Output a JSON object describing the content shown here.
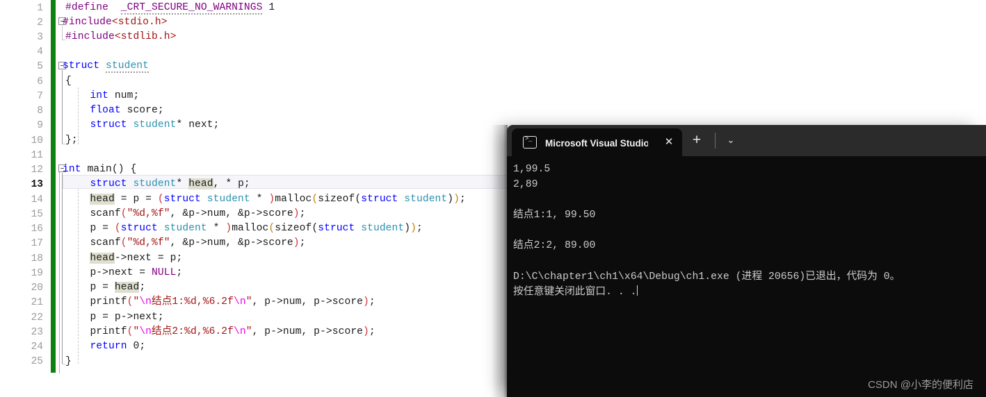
{
  "editor": {
    "line_numbers": [
      "1",
      "2",
      "3",
      "4",
      "5",
      "6",
      "7",
      "8",
      "9",
      "10",
      "11",
      "12",
      "13",
      "14",
      "15",
      "16",
      "17",
      "18",
      "19",
      "20",
      "21",
      "22",
      "23",
      "24",
      "25"
    ],
    "current_line": "13",
    "lines": [
      "#define  _CRT_SECURE_NO_WARNINGS 1",
      "#include<stdio.h>",
      "#include<stdlib.h>",
      "",
      "struct student",
      "{",
      "    int num;",
      "    float score;",
      "    struct student* next;",
      "};",
      "",
      "int main() {",
      "    struct student* head, * p;",
      "    head = p = (struct student * )malloc(sizeof(struct student));",
      "    scanf(\"%d,%f\", &p->num, &p->score);",
      "    p = (struct student * )malloc(sizeof(struct student));",
      "    scanf(\"%d,%f\", &p->num, &p->score);",
      "    head->next = p;",
      "    p->next = NULL;",
      "    p = head;",
      "    printf(\"\\n结点1:%d,%6.2f\\n\", p->num, p->score);",
      "    p = p->next;",
      "    printf(\"\\n结点2:%d,%6.2f\\n\", p->num, p->score);",
      "    return 0;",
      "}"
    ],
    "highlighted_symbol": "head",
    "change_bar_color": "#108010"
  },
  "console": {
    "tab_title": "Microsoft Visual Studio 调试控制台",
    "tab_icon": "console-icon",
    "close_label": "✕",
    "new_tab_label": "+",
    "dropdown_label": "⌄",
    "output": [
      "1,99.5",
      "2,89",
      "",
      "结点1:1, 99.50",
      "",
      "结点2:2, 89.00",
      "",
      "D:\\C\\chapter1\\ch1\\x64\\Debug\\ch1.exe (进程 20656)已退出，代码为 0。",
      "按任意键关闭此窗口. . ."
    ],
    "background": "#0c0c0c",
    "titlebar_background": "#2b2b2b"
  },
  "watermark": {
    "text": "CSDN @小李的便利店"
  }
}
